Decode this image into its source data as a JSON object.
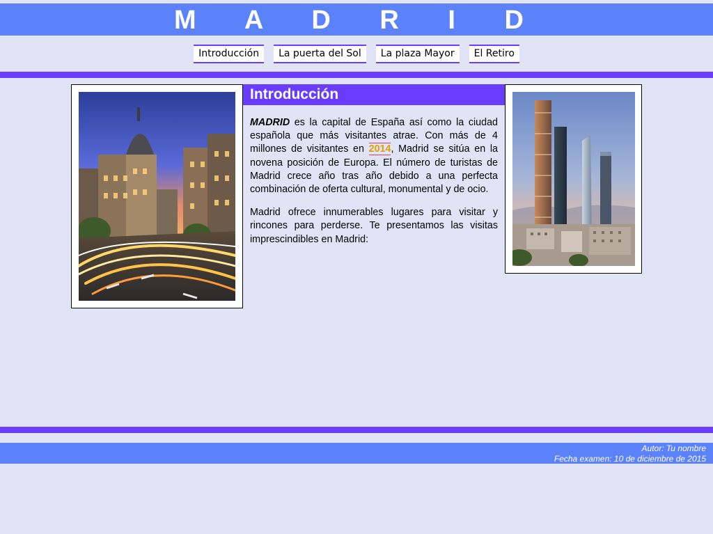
{
  "header": {
    "title": "M A D R I D"
  },
  "nav": {
    "items": [
      {
        "label": "Introducción"
      },
      {
        "label": "La puerta del Sol"
      },
      {
        "label": "La plaza Mayor"
      },
      {
        "label": "El Retiro"
      }
    ]
  },
  "section": {
    "heading": "Introducción",
    "para1_city": "MADRID",
    "para1_a": " es la capital de España así como la ciudad española que más visitantes atrae. Con más de 4 millones de visitantes en ",
    "para1_year": "2014",
    "para1_b": ", Madrid se sitúa en la novena posición de Europa. El número de turistas de Madrid crece año tras año debido a una perfecta combinación de oferta cultural, monumental y de ocio.",
    "para2": "Madrid ofrece innumerables lugares para visitar y rincones para perderse. Te presentamos las visitas imprescindibles en Madrid:"
  },
  "photos": {
    "left": {
      "icon": "city-street-night-photo"
    },
    "right": {
      "icon": "skyscrapers-photo"
    }
  },
  "footer": {
    "author": "Autor: Tu nombre",
    "exam_date": "Fecha examen: 10 de diciembre de 2015"
  },
  "colors": {
    "header_blue": "#5b82f8",
    "accent_purple": "#6a3cff",
    "page_bg": "#e0e4f6",
    "year_highlight": "#e0a000"
  }
}
